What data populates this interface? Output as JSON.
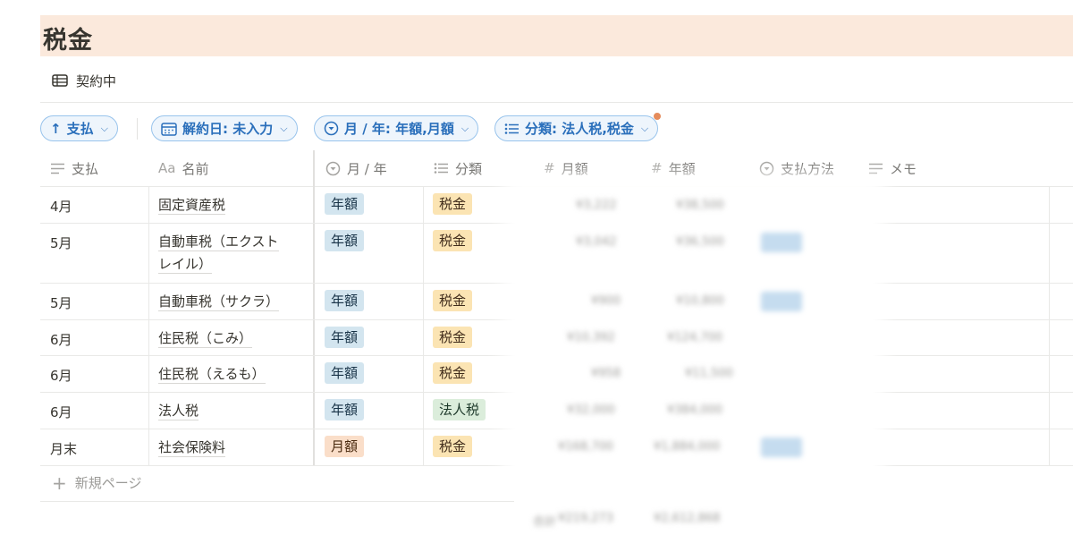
{
  "page": {
    "title": "税金"
  },
  "view": {
    "name": "契約中",
    "icon": "table-icon"
  },
  "filters": {
    "sort": {
      "label": "支払",
      "icon": "arrow-up-icon"
    },
    "chips": [
      {
        "label": "解約日: 未入力",
        "icon": "calendar-icon"
      },
      {
        "label": "月 / 年: 年額,月額",
        "icon": "select-icon"
      },
      {
        "label": "分類: 法人税,税金",
        "icon": "list-icon"
      }
    ]
  },
  "columns": [
    {
      "label": "支払",
      "icon": "text-lines-icon"
    },
    {
      "label": "名前",
      "icon_text": "Aa"
    },
    {
      "label": "月 / 年",
      "icon": "select-icon"
    },
    {
      "label": "分類",
      "icon": "list-icon"
    },
    {
      "label": "月額",
      "icon_text": "#"
    },
    {
      "label": "年額",
      "icon_text": "#"
    },
    {
      "label": "支払方法",
      "icon": "select-icon"
    },
    {
      "label": "メモ",
      "icon": "text-lines-icon"
    }
  ],
  "rows": [
    {
      "pay": "4月",
      "name": "固定資産税",
      "name2": "",
      "period": "年額",
      "period_color": "blue",
      "category": "税金",
      "category_color": "yellow",
      "monthly": "¥3,222",
      "yearly": "¥38,500",
      "method": ""
    },
    {
      "pay": "5月",
      "name": "自動車税（エクスト",
      "name2": "レイル）",
      "period": "年額",
      "period_color": "blue",
      "category": "税金",
      "category_color": "yellow",
      "monthly": "¥3,042",
      "yearly": "¥36,500",
      "method": "■■■"
    },
    {
      "pay": "5月",
      "name": "自動車税（サクラ）",
      "name2": "",
      "period": "年額",
      "period_color": "blue",
      "category": "税金",
      "category_color": "yellow",
      "monthly": "¥900",
      "yearly": "¥10,800",
      "method": "■■■"
    },
    {
      "pay": "6月",
      "name": "住民税（こみ）",
      "name2": "",
      "period": "年額",
      "period_color": "blue",
      "category": "税金",
      "category_color": "yellow",
      "monthly": "¥10,392",
      "yearly": "¥124,700",
      "method": ""
    },
    {
      "pay": "6月",
      "name": "住民税（えるも）",
      "name2": "",
      "period": "年額",
      "period_color": "blue",
      "category": "税金",
      "category_color": "yellow",
      "monthly": "¥958",
      "yearly": "¥11,500",
      "method": ""
    },
    {
      "pay": "6月",
      "name": "法人税",
      "name2": "",
      "period": "年額",
      "period_color": "blue",
      "category": "法人税",
      "category_color": "green",
      "monthly": "¥32,000",
      "yearly": "¥384,000",
      "method": ""
    },
    {
      "pay": "月末",
      "name": "社会保険料",
      "name2": "",
      "period": "月額",
      "period_color": "orange",
      "category": "税金",
      "category_color": "yellow",
      "monthly": "¥168,700",
      "yearly": "¥1,884,000",
      "method": "■■■"
    }
  ],
  "new_page": {
    "label": "新規ページ"
  },
  "totals": {
    "label": "合計",
    "monthly": "¥219,273",
    "yearly": "¥2,612,868"
  }
}
